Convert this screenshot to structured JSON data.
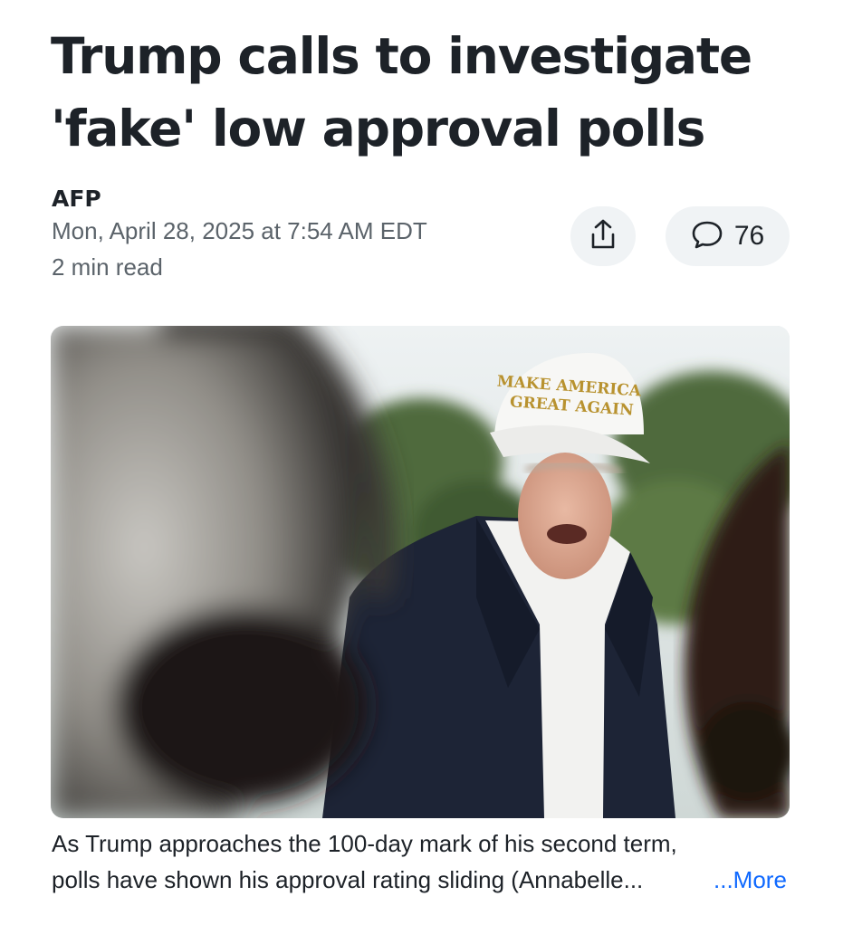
{
  "article": {
    "headline": "Trump calls to investigate 'fake' low approval polls",
    "source": "AFP",
    "timestamp": "Mon, April 28, 2025 at 7:54 AM EDT",
    "read_time": "2 min read"
  },
  "actions": {
    "share_icon": "share-icon",
    "comment_icon": "comment-bubble-icon",
    "comment_count": "76"
  },
  "hero_image": {
    "cap_text_line1": "MAKE AMERICA",
    "cap_text_line2": "GREAT AGAIN"
  },
  "caption": {
    "line1": "As Trump approaches the 100-day mark of his second term,",
    "line2": "polls have shown his approval rating sliding (Annabelle...",
    "more_label": "...More"
  },
  "colors": {
    "text": "#1d2228",
    "muted": "#5b636a",
    "pill_bg": "#f0f3f5",
    "link": "#0f69ff"
  }
}
